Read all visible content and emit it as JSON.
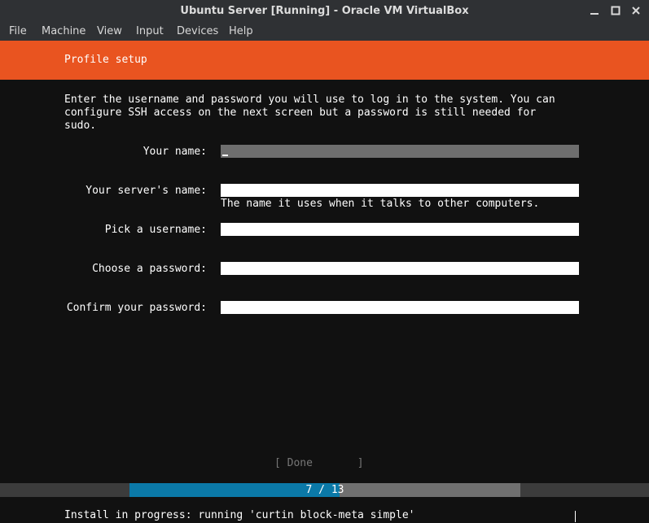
{
  "window": {
    "title": "Ubuntu Server [Running] - Oracle VM VirtualBox"
  },
  "menubar": {
    "items": [
      {
        "label": "File"
      },
      {
        "label": "Machine"
      },
      {
        "label": "View"
      },
      {
        "label": "Input"
      },
      {
        "label": "Devices"
      },
      {
        "label": "Help"
      }
    ]
  },
  "installer": {
    "header_title": "Profile setup",
    "header_color": "#e95420",
    "intro": "Enter the username and password you will use to log in to the system. You can\nconfigure SSH access on the next screen but a password is still needed for\nsudo.",
    "fields": [
      {
        "label": "Your name:",
        "value": ""
      },
      {
        "label": "Your server's name:",
        "value": "",
        "help": "The name it uses when it talks to other computers."
      },
      {
        "label": "Pick a username:",
        "value": ""
      },
      {
        "label": "Choose a password:",
        "value": ""
      },
      {
        "label": "Confirm your password:",
        "value": ""
      }
    ],
    "done_label": "[ Done       ]",
    "progress": {
      "text": "7 / 13",
      "current": 7,
      "total": 13,
      "fill_color": "#0b79a8"
    },
    "status": "Install in progress: running 'curtin block-meta simple'"
  }
}
